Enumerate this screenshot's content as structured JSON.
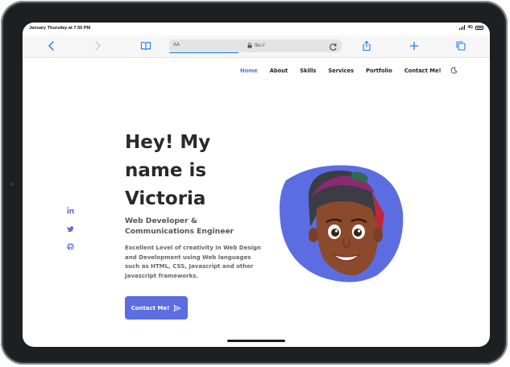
{
  "status": {
    "time": "January Thursday at 7:55 PM",
    "network": "4G"
  },
  "browser": {
    "aa_label": "AA",
    "url": "file://"
  },
  "nav": {
    "items": [
      "Home",
      "About",
      "Skills",
      "Services",
      "Portfolio",
      "Contact Me!"
    ],
    "active": "Home"
  },
  "hero": {
    "title_line1": "Hey! My",
    "title_line2": "name is",
    "title_line3": "Victoria",
    "subtitle_line1": "Web Developer &",
    "subtitle_line2": "Communications Engineer",
    "desc_line1": "Excellent Level of creativity in Web Design",
    "desc_line2": "and Development using Web languages",
    "desc_line3": "such as HTML, CSS, Javascript and other",
    "desc_line4": "Javascript frameworks.",
    "cta_label": "Contact Me!"
  },
  "social": [
    "linkedin-icon",
    "twitter-icon",
    "github-icon"
  ],
  "colors": {
    "accent": "#5b6de0",
    "browser_blue": "#1f7bf2",
    "title": "#2a2a2a"
  }
}
